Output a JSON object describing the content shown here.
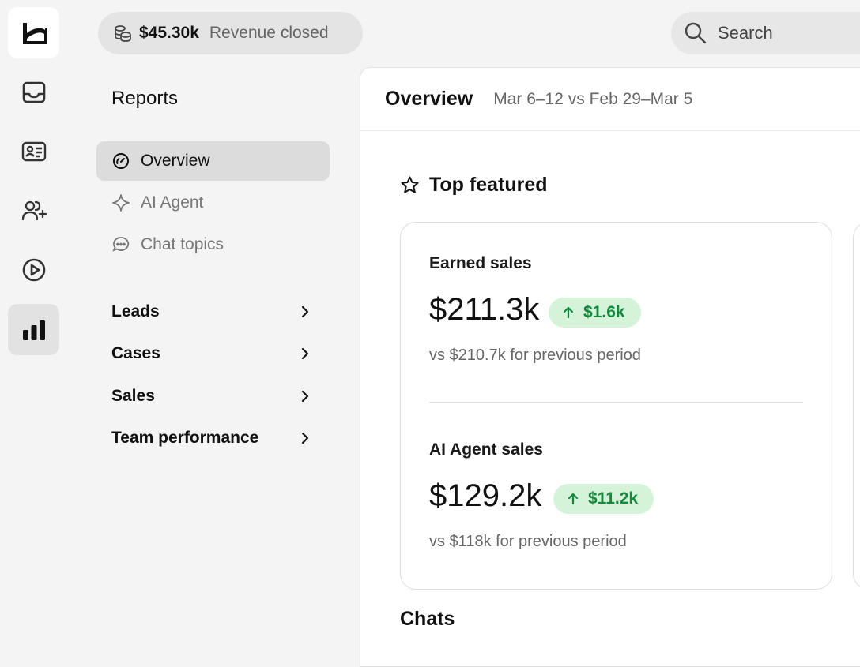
{
  "rail": {
    "items": [
      "logo",
      "inbox-icon",
      "contact-card-icon",
      "users-plus-icon",
      "play-circle-icon",
      "bar-chart-icon"
    ],
    "active": "bar-chart-icon"
  },
  "topbar": {
    "revenue_amount": "$45.30k",
    "revenue_label": "Revenue closed",
    "search_label": "Search"
  },
  "sidebar": {
    "title": "Reports",
    "items": [
      {
        "label": "Overview",
        "icon": "gauge-icon",
        "active": true
      },
      {
        "label": "AI Agent",
        "icon": "sparkle-icon",
        "active": false
      },
      {
        "label": "Chat topics",
        "icon": "chat-bubble-icon",
        "active": false
      }
    ],
    "groups": [
      {
        "label": "Leads"
      },
      {
        "label": "Cases"
      },
      {
        "label": "Sales"
      },
      {
        "label": "Team performance"
      }
    ]
  },
  "main": {
    "title": "Overview",
    "date_range": "Mar 6–12 vs Feb 29–Mar 5",
    "section_title": "Top featured",
    "metrics": [
      {
        "label": "Earned sales",
        "value": "$211.3k",
        "delta": "$1.6k",
        "comparison": "vs $210.7k for previous period"
      },
      {
        "label": "AI Agent sales",
        "value": "$129.2k",
        "delta": "$11.2k",
        "comparison": "vs $118k for previous period"
      }
    ],
    "chats_title": "Chats"
  },
  "colors": {
    "accent_green_text": "#138a3b",
    "accent_green_bg": "#d4f3d9",
    "active_bg": "#dcdcdc"
  }
}
